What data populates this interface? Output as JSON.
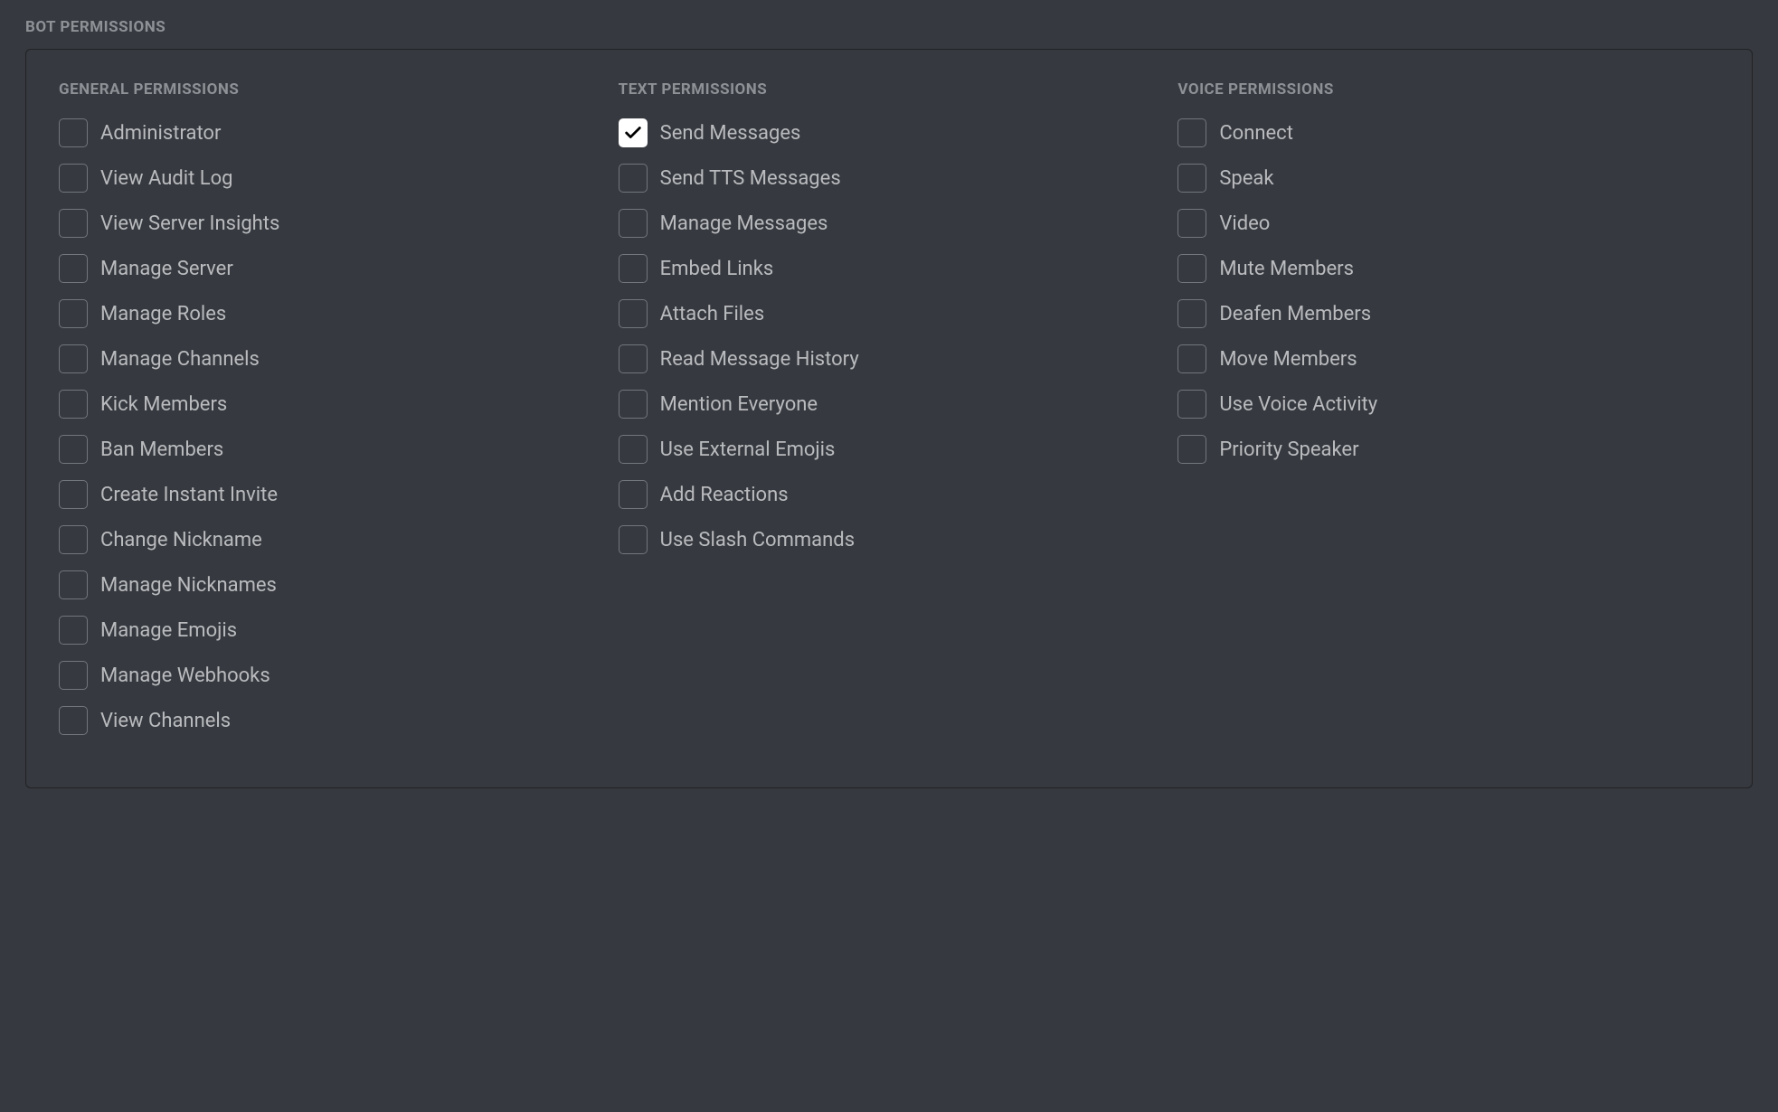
{
  "section_title": "Bot Permissions",
  "columns": [
    {
      "title": "General Permissions",
      "items": [
        {
          "label": "Administrator",
          "checked": false
        },
        {
          "label": "View Audit Log",
          "checked": false
        },
        {
          "label": "View Server Insights",
          "checked": false
        },
        {
          "label": "Manage Server",
          "checked": false
        },
        {
          "label": "Manage Roles",
          "checked": false
        },
        {
          "label": "Manage Channels",
          "checked": false
        },
        {
          "label": "Kick Members",
          "checked": false
        },
        {
          "label": "Ban Members",
          "checked": false
        },
        {
          "label": "Create Instant Invite",
          "checked": false
        },
        {
          "label": "Change Nickname",
          "checked": false
        },
        {
          "label": "Manage Nicknames",
          "checked": false
        },
        {
          "label": "Manage Emojis",
          "checked": false
        },
        {
          "label": "Manage Webhooks",
          "checked": false
        },
        {
          "label": "View Channels",
          "checked": false
        }
      ]
    },
    {
      "title": "Text Permissions",
      "items": [
        {
          "label": "Send Messages",
          "checked": true
        },
        {
          "label": "Send TTS Messages",
          "checked": false
        },
        {
          "label": "Manage Messages",
          "checked": false
        },
        {
          "label": "Embed Links",
          "checked": false
        },
        {
          "label": "Attach Files",
          "checked": false
        },
        {
          "label": "Read Message History",
          "checked": false
        },
        {
          "label": "Mention Everyone",
          "checked": false
        },
        {
          "label": "Use External Emojis",
          "checked": false
        },
        {
          "label": "Add Reactions",
          "checked": false
        },
        {
          "label": "Use Slash Commands",
          "checked": false
        }
      ]
    },
    {
      "title": "Voice Permissions",
      "items": [
        {
          "label": "Connect",
          "checked": false
        },
        {
          "label": "Speak",
          "checked": false
        },
        {
          "label": "Video",
          "checked": false
        },
        {
          "label": "Mute Members",
          "checked": false
        },
        {
          "label": "Deafen Members",
          "checked": false
        },
        {
          "label": "Move Members",
          "checked": false
        },
        {
          "label": "Use Voice Activity",
          "checked": false
        },
        {
          "label": "Priority Speaker",
          "checked": false
        }
      ]
    }
  ]
}
